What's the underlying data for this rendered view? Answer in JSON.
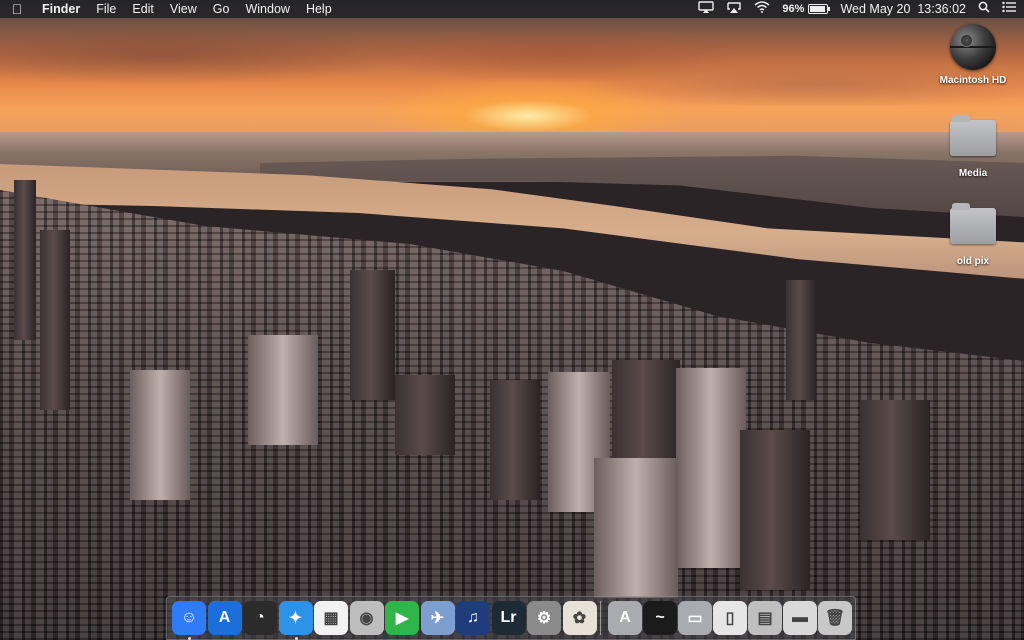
{
  "menubar": {
    "apple_icon": "apple-icon",
    "items": [
      "Finder",
      "File",
      "Edit",
      "View",
      "Go",
      "Window",
      "Help"
    ],
    "status": {
      "icons": [
        "airplay-display-icon",
        "airplay-icon",
        "wifi-icon"
      ],
      "battery_percent": "96%",
      "battery_level": 0.96,
      "clock": "Wed May 20  13:36:02",
      "spotlight_icon": "search-icon",
      "notification_icon": "list-icon"
    }
  },
  "desktop": {
    "icons": [
      {
        "label": "Macintosh HD",
        "icon": "hard-drive-icon"
      },
      {
        "label": "Media",
        "icon": "folder-icon"
      },
      {
        "label": "old pix",
        "icon": "folder-icon"
      }
    ]
  },
  "dock": {
    "apps": [
      {
        "name": "finder",
        "glyph": "☺",
        "color": "#2f7cf6",
        "running": true
      },
      {
        "name": "app-store",
        "glyph": "A",
        "color": "#1c6fd9",
        "running": false
      },
      {
        "name": "dashboard",
        "glyph": "◔",
        "color": "#2b2b2b",
        "running": false
      },
      {
        "name": "safari",
        "glyph": "✦",
        "color": "#2e92e8",
        "running": true
      },
      {
        "name": "launchpad",
        "glyph": "▦",
        "color": "#f2f2f2",
        "running": false
      },
      {
        "name": "dvd-player",
        "glyph": "◉",
        "color": "#bdbdbd",
        "running": false
      },
      {
        "name": "facetime",
        "glyph": "▶",
        "color": "#2fb54a",
        "running": false
      },
      {
        "name": "preview",
        "glyph": "✈",
        "color": "#7d9fcf",
        "running": false
      },
      {
        "name": "itunes",
        "glyph": "♫",
        "color": "#1e3d7a",
        "running": false
      },
      {
        "name": "lightroom",
        "glyph": "Lr",
        "color": "#1d2b35",
        "running": false
      },
      {
        "name": "system-preferences",
        "glyph": "⚙",
        "color": "#8a8a8a",
        "running": false
      },
      {
        "name": "photos",
        "glyph": "✿",
        "color": "#e7e2d5",
        "running": false
      }
    ],
    "docs": [
      {
        "name": "applications-folder",
        "glyph": "A",
        "color": "#a9abb0"
      },
      {
        "name": "activity-monitor",
        "glyph": "~",
        "color": "#1b1b1b"
      },
      {
        "name": "documents-folder",
        "glyph": "▭",
        "color": "#a9abb0"
      },
      {
        "name": "downloads-stack",
        "glyph": "▯",
        "color": "#e6e6e6"
      },
      {
        "name": "document-stack",
        "glyph": "▤",
        "color": "#bfbfbf"
      },
      {
        "name": "downloads-folder",
        "glyph": "▬",
        "color": "#d9d9d9"
      },
      {
        "name": "trash",
        "glyph": "🗑",
        "color": "#c8c8c8"
      }
    ]
  }
}
